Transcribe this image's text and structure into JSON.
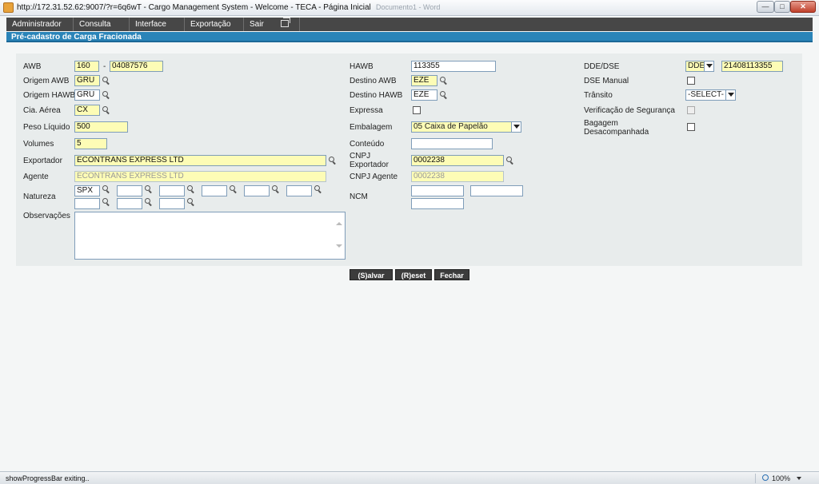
{
  "window": {
    "title": "http://172.31.52.62:9007/?r=6q6wT - Cargo Management System - Welcome - TECA - Página Inicial",
    "ghost_title": "Documento1 - Word",
    "minimize": "—",
    "maximize": "□",
    "close": "✕"
  },
  "menu": [
    {
      "label": "Administrador"
    },
    {
      "label": "Consulta"
    },
    {
      "label": "Interface"
    },
    {
      "label": "Exportação"
    },
    {
      "label": "Sair"
    }
  ],
  "section_title": "Pré-cadastro de Carga Fracionada",
  "form": {
    "awb": {
      "label": "AWB",
      "prefix": "160",
      "separator": "-",
      "number": "04087576"
    },
    "origem_awb": {
      "label": "Origem AWB",
      "value": "GRU"
    },
    "origem_hawb": {
      "label": "Origem HAWB",
      "value": "GRU"
    },
    "cia_aerea": {
      "label": "Cia. Aérea",
      "value": "CX"
    },
    "peso_liquido": {
      "label": "Peso Líquido",
      "value": "500"
    },
    "volumes": {
      "label": "Volumes",
      "value": "5"
    },
    "exportador": {
      "label": "Exportador",
      "value": "ECONTRANS EXPRESS LTD"
    },
    "agente": {
      "label": "Agente",
      "value": "ECONTRANS EXPRESS LTD"
    },
    "natureza": {
      "label": "Natureza",
      "values": [
        "SPX",
        "",
        "",
        "",
        "",
        "",
        "",
        "",
        ""
      ]
    },
    "observacoes": {
      "label": "Observações",
      "value": ""
    },
    "hawb": {
      "label": "HAWB",
      "value": "113355"
    },
    "destino_awb": {
      "label": "Destino AWB",
      "value": "EZE"
    },
    "destino_hawb": {
      "label": "Destino HAWB",
      "value": "EZE"
    },
    "expressa": {
      "label": "Expressa",
      "checked": false
    },
    "embalagem": {
      "label": "Embalagem",
      "value": "05 Caixa de Papelão"
    },
    "conteudo": {
      "label": "Conteúdo",
      "value": ""
    },
    "cnpj_exportador": {
      "label_line1": "CNPJ",
      "label_line2": "Exportador",
      "value": "0002238"
    },
    "cnpj_agente": {
      "label": "CNPJ Agente",
      "value": "0002238"
    },
    "ncm": {
      "label": "NCM",
      "values": [
        "",
        "",
        ""
      ]
    },
    "dde_dse": {
      "label": "DDE/DSE",
      "type": "DDE",
      "value": "21408113355"
    },
    "dse_manual": {
      "label": "DSE Manual",
      "checked": false
    },
    "transito": {
      "label": "Trânsito",
      "value": "-SELECT-"
    },
    "verificacao_seguranca": {
      "label": "Verificação de Segurança",
      "checked": false
    },
    "bagagem": {
      "label_line1": "Bagagem",
      "label_line2": "Desacompanhada",
      "checked": false
    }
  },
  "buttons": {
    "salvar": "(S)alvar",
    "reset": "(R)eset",
    "fechar": "Fechar"
  },
  "status": {
    "text": "showProgressBar exiting..",
    "zoom": "100%"
  },
  "colors": {
    "menu_bg": "#474747",
    "section_bg": "#2a84b8",
    "required_field": "#fdfcb6",
    "panel_bg": "#e8ecec"
  }
}
